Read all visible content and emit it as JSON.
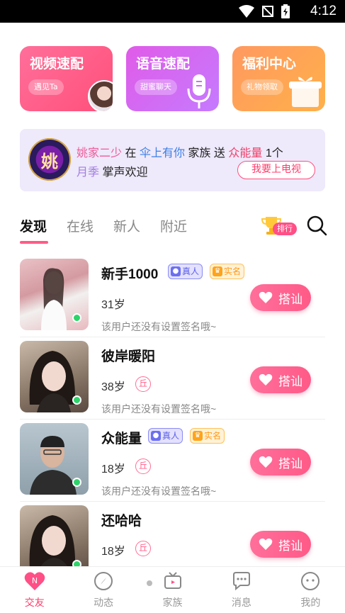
{
  "status_bar": {
    "time": "4:12"
  },
  "cards": [
    {
      "title": "视频速配",
      "pill": "遇见Ta",
      "icon": "avatar-photo-icon"
    },
    {
      "title": "语音速配",
      "pill": "甜蜜聊天",
      "icon": "microphone-icon"
    },
    {
      "title": "福利中心",
      "pill": "礼物领取",
      "icon": "gift-box-icon"
    }
  ],
  "banner": {
    "logo_text": "姚",
    "user": "姚家二少",
    "word_at": "在",
    "family": "伞上有你",
    "word_family": "家族",
    "word_send": "送",
    "gift_to": "众能量",
    "count": "1个",
    "gift": "月季",
    "applause": "掌声欢迎",
    "button": "我要上电视"
  },
  "tabs": [
    "发现",
    "在线",
    "新人",
    "附近"
  ],
  "active_tab": 0,
  "rank_label": "排行",
  "users": [
    {
      "name": "新手1000",
      "real": "真人",
      "verified": "实名",
      "age": "31岁",
      "zodiac": "",
      "signature": "该用户还没有设置签名哦~",
      "action": "搭讪"
    },
    {
      "name": "彼岸暖阳",
      "real": "",
      "verified": "",
      "age": "38岁",
      "zodiac": "丘",
      "signature": "该用户还没有设置签名哦~",
      "action": "搭讪"
    },
    {
      "name": "众能量",
      "real": "真人",
      "verified": "实名",
      "age": "18岁",
      "zodiac": "丘",
      "signature": "该用户还没有设置签名哦~",
      "action": "搭讪"
    },
    {
      "name": "还哈哈",
      "real": "",
      "verified": "",
      "age": "18岁",
      "zodiac": "丘",
      "signature": "",
      "action": "搭讪"
    }
  ],
  "nav": [
    "交友",
    "动态",
    "家族",
    "消息",
    "我的"
  ],
  "colors": {
    "accent": "#ff5b88",
    "online": "#2ed46a",
    "banner_bg": "#eee9fb"
  }
}
